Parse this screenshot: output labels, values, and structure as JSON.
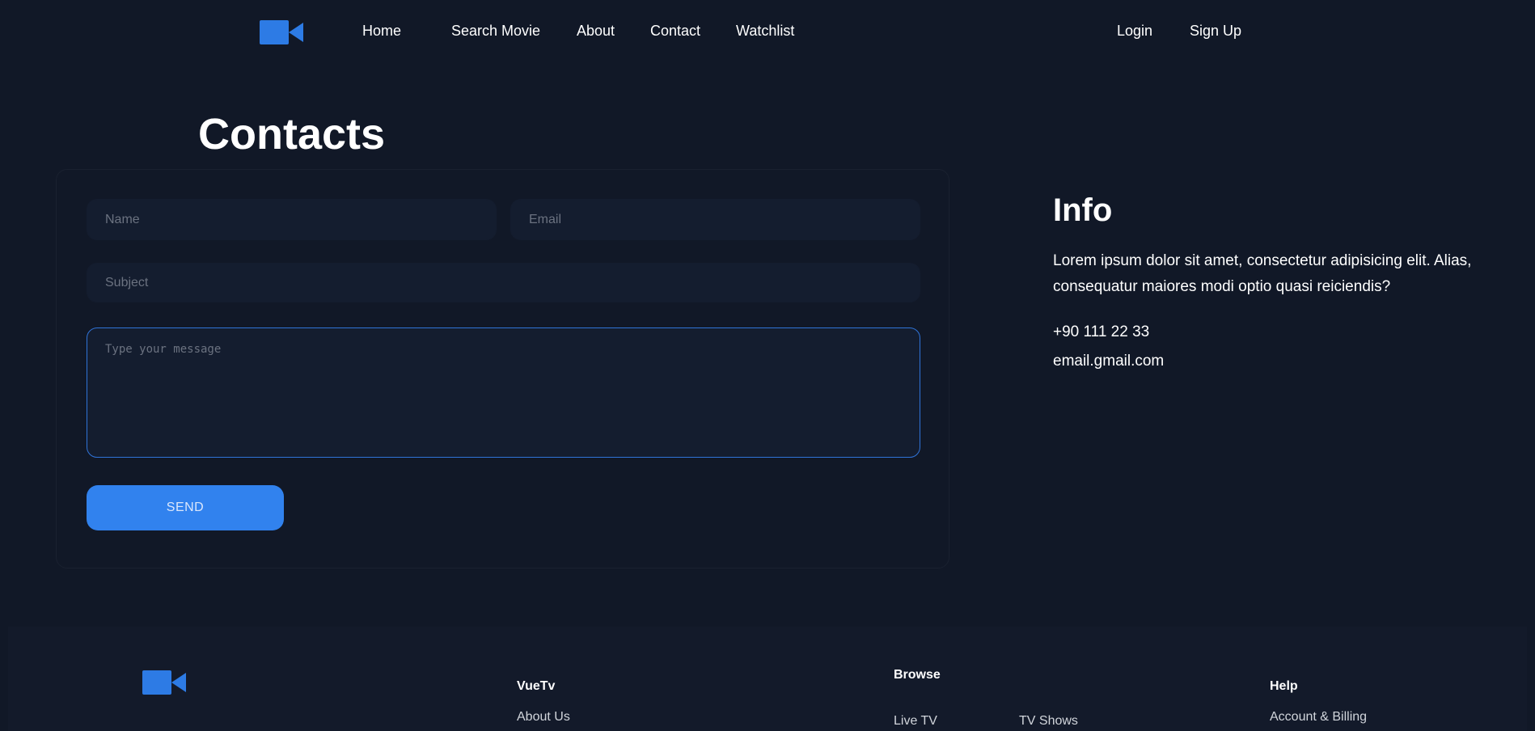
{
  "nav": {
    "logo_icon": "video-camera-icon",
    "links": [
      "Home",
      "Search Movie",
      "About",
      "Contact",
      "Watchlist"
    ],
    "auth": [
      "Login",
      "Sign Up"
    ]
  },
  "contacts": {
    "title": "Contacts",
    "form": {
      "name_placeholder": "Name",
      "email_placeholder": "Email",
      "subject_placeholder": "Subject",
      "message_placeholder": "Type your message",
      "send_label": "SEND"
    }
  },
  "info": {
    "title": "Info",
    "description": "Lorem ipsum dolor sit amet, consectetur adipisicing elit. Alias, consequatur maiores modi optio quasi reiciendis?",
    "phone": "+90 111 22 33",
    "email": "email.gmail.com"
  },
  "footer": {
    "logo_icon": "video-camera-icon",
    "columns": [
      {
        "heading": "VueTv",
        "links": [
          "About Us"
        ]
      },
      {
        "heading": "Browse",
        "links": [
          "Live TV",
          "TV Shows"
        ]
      },
      {
        "heading": "Help",
        "links": [
          "Account & Billing"
        ]
      }
    ]
  },
  "colors": {
    "background": "#111827",
    "surface": "#141d2f",
    "accent": "#3182ee",
    "text": "#ffffff"
  }
}
